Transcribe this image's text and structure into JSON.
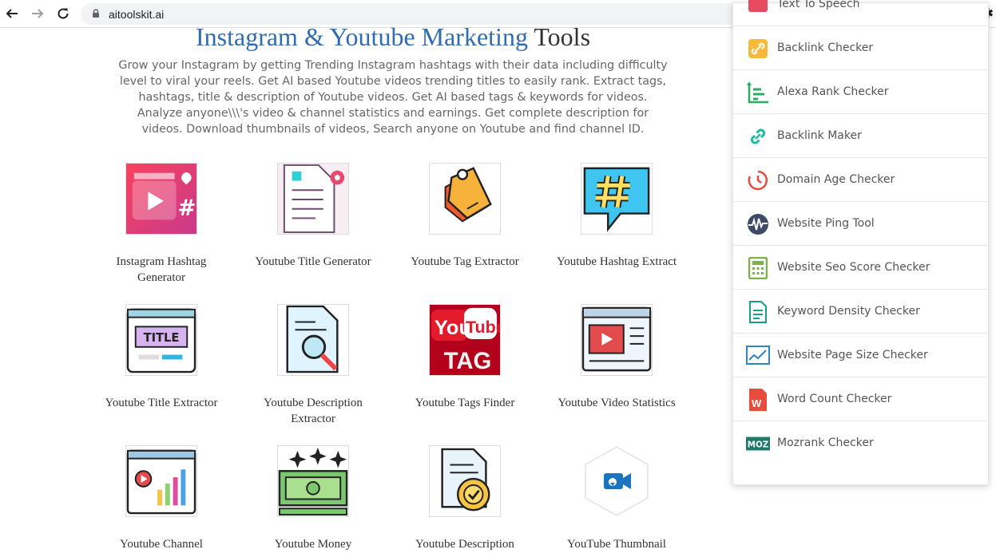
{
  "browser": {
    "url": "aitoolskit.ai"
  },
  "main": {
    "title_highlight": "Instagram & Youtube Marketing",
    "title_rest": "Tools",
    "intro": "Grow your Instagram by getting Trending Instagram hashtags with their data including difficulty level to viral your reels. Get AI based Youtube videos trending titles to easily rank. Extract tags, hashtags, title & description of Youtube videos. Get AI based tags & keywords for videos. Analyze anyone\\\\\\'s video & channel statistics and earnings. Get complete description for videos. Download thumbnails of videos, Search anyone on Youtube and find channel ID.",
    "tools": [
      {
        "label": "Instagram Hashtag Generator",
        "icon": "instagram-hashtag-icon"
      },
      {
        "label": "Youtube Title Generator",
        "icon": "document-gear-icon"
      },
      {
        "label": "Youtube Tag Extractor",
        "icon": "tag-icon"
      },
      {
        "label": "Youtube Hashtag Extract",
        "icon": "hashtag-bubble-icon"
      },
      {
        "label": "Youtube Title Extractor",
        "icon": "title-box-icon"
      },
      {
        "label": "Youtube Description Extractor",
        "icon": "document-search-icon"
      },
      {
        "label": "Youtube Tags Finder",
        "icon": "youtube-tag-icon"
      },
      {
        "label": "Youtube Video Statistics",
        "icon": "video-window-icon"
      },
      {
        "label": "Youtube Channel Statistics",
        "icon": "channel-chart-icon"
      },
      {
        "label": "Youtube Money Calculator",
        "icon": "money-icon"
      },
      {
        "label": "Youtube Description Generator",
        "icon": "document-badge-icon"
      },
      {
        "label": "YouTube Thumbnail Downloader",
        "icon": "video-camera-icon"
      }
    ]
  },
  "sidebar": {
    "items": [
      {
        "label": "Text To Speech",
        "icon": "text-to-speech-icon"
      },
      {
        "label": "Backlink Checker",
        "icon": "link-icon"
      },
      {
        "label": "Alexa Rank Checker",
        "icon": "rank-chart-icon"
      },
      {
        "label": "Backlink Maker",
        "icon": "chain-link-icon"
      },
      {
        "label": "Domain Age Checker",
        "icon": "clock-icon"
      },
      {
        "label": "Website Ping Tool",
        "icon": "pulse-icon"
      },
      {
        "label": "Website Seo Score Checker",
        "icon": "calculator-icon"
      },
      {
        "label": "Keyword Density Checker",
        "icon": "document-lines-icon"
      },
      {
        "label": "Website Page Size Checker",
        "icon": "line-chart-icon"
      },
      {
        "label": "Word Count Checker",
        "icon": "word-doc-icon"
      },
      {
        "label": "Mozrank Checker",
        "icon": "moz-icon",
        "icon_text": "MOZ"
      }
    ]
  },
  "colors": {
    "title_blue": "#2f6cb0",
    "address_bg": "#f1f3f4"
  }
}
